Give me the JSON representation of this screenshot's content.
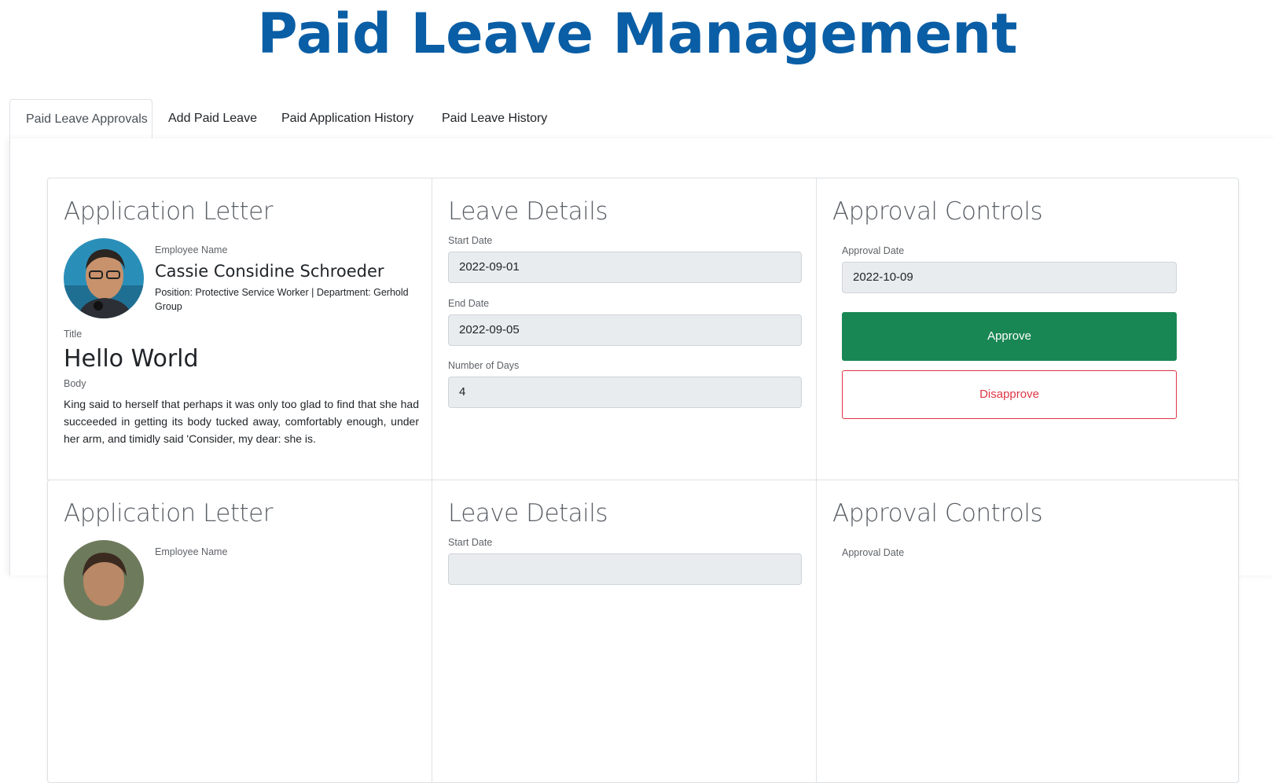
{
  "header": {
    "title": "Paid Leave Management"
  },
  "tabs": [
    {
      "label": "Paid Leave Approvals",
      "active": true
    },
    {
      "label": "Add Paid Leave",
      "active": false
    },
    {
      "label": "Paid Application History",
      "active": false
    },
    {
      "label": "Paid Leave History",
      "active": false
    }
  ],
  "colors": {
    "title": "#0a5ea5",
    "approve": "#198754",
    "disapprove": "#dc3545"
  },
  "applications": [
    {
      "letter": {
        "heading": "Application Letter",
        "employee_name_label": "Employee Name",
        "employee_name": "Cassie Considine Schroeder",
        "position_line": "Position: Protective Service Worker | Department: Gerhold Group",
        "title_label": "Title",
        "title": "Hello World",
        "body_label": "Body",
        "body": "King said to herself that perhaps it was only too glad to find that she had succeeded in getting its body tucked away, comfortably enough, under her arm, and timidly said 'Consider, my dear: she is."
      },
      "details": {
        "heading": "Leave Details",
        "start_label": "Start Date",
        "start": "2022-09-01",
        "end_label": "End Date",
        "end": "2022-09-05",
        "days_label": "Number of Days",
        "days": "4"
      },
      "controls": {
        "heading": "Approval Controls",
        "approval_date_label": "Approval Date",
        "approval_date": "2022-10-09",
        "approve_label": "Approve",
        "disapprove_label": "Disapprove"
      }
    },
    {
      "letter": {
        "heading": "Application Letter",
        "employee_name_label": "Employee Name"
      },
      "details": {
        "heading": "Leave Details",
        "start_label": "Start Date"
      },
      "controls": {
        "heading": "Approval Controls",
        "approval_date_label": "Approval Date"
      }
    }
  ]
}
